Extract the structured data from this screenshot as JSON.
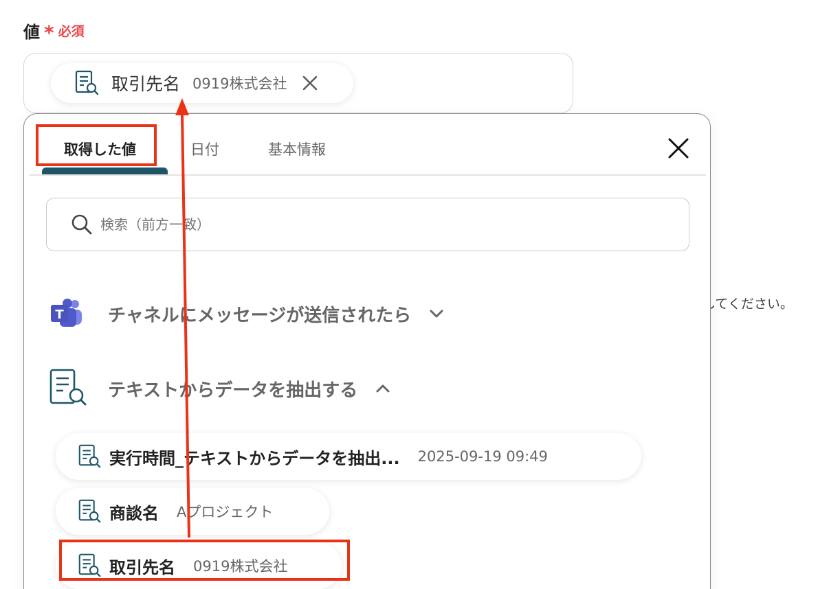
{
  "field": {
    "label": "値",
    "required_mark": "*",
    "required_text": "必須"
  },
  "selected_chip": {
    "name": "取引先名",
    "value": "0919株式会社"
  },
  "background_text": "してください。",
  "panel": {
    "tabs": [
      {
        "label": "取得した値",
        "active": true
      },
      {
        "label": "日付",
        "active": false
      },
      {
        "label": "基本情報",
        "active": false
      }
    ],
    "search": {
      "placeholder": "検索（前方一致）"
    },
    "groups": [
      {
        "name": "チャネルにメッセージが送信されたら",
        "icon": "teams-icon",
        "expanded": false
      },
      {
        "name": "テキストからデータを抽出する",
        "icon": "text-extract-icon",
        "expanded": true
      }
    ],
    "items": [
      {
        "name": "実行時間_テキストからデータを抽出...",
        "value": "2025-09-19 09:49"
      },
      {
        "name": "商談名",
        "value": "Aプロジェクト"
      },
      {
        "name": "取引先名",
        "value": "0919株式会社"
      }
    ]
  },
  "colors": {
    "accent": "#1f5667",
    "required": "#e8474c",
    "annotation": "#ea3217"
  }
}
